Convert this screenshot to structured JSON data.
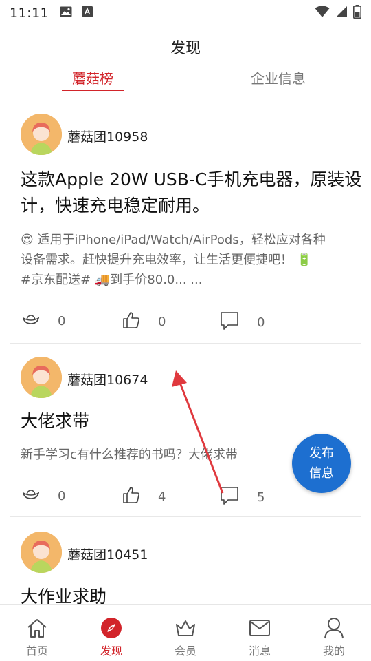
{
  "status_bar": {
    "time": "11:11"
  },
  "header": {
    "title": "发现"
  },
  "tabs": [
    {
      "label": "蘑菇榜",
      "active": true
    },
    {
      "label": "企业信息",
      "active": false
    }
  ],
  "posts": [
    {
      "author": "蘑菇团10958",
      "title": "这款Apple 20W USB-C手机充电器，原装设计，快速充电稳定耐用。",
      "body_line1": "😍 适用于iPhone/iPad/Watch/AirPods，轻松应对各种",
      "body_line2": "设备需求。赶快提升充电效率，让生活更便捷吧！ 🔋",
      "body_line3": "#京东配送# 🚚到手价80.0... ...",
      "rewards": "0",
      "likes": "0",
      "comments": "0"
    },
    {
      "author": "蘑菇团10674",
      "title": "大佬求带",
      "body_line1": "新手学习c有什么推荐的书吗？大佬求带",
      "rewards": "0",
      "likes": "4",
      "comments": "5"
    },
    {
      "author": "蘑菇团10451",
      "title": "大作业求助"
    }
  ],
  "fab": {
    "line1": "发布",
    "line2": "信息"
  },
  "bottom_nav": [
    {
      "label": "首页",
      "icon": "home-icon",
      "active": false
    },
    {
      "label": "发现",
      "icon": "compass-icon",
      "active": true
    },
    {
      "label": "会员",
      "icon": "crown-icon",
      "active": false
    },
    {
      "label": "消息",
      "icon": "mail-icon",
      "active": false
    },
    {
      "label": "我的",
      "icon": "user-icon",
      "active": false
    }
  ],
  "colors": {
    "accent": "#d2242a",
    "fab": "#1d6fd0",
    "avatar_bg": "#f3b76a",
    "annotation": "#e0393e"
  }
}
